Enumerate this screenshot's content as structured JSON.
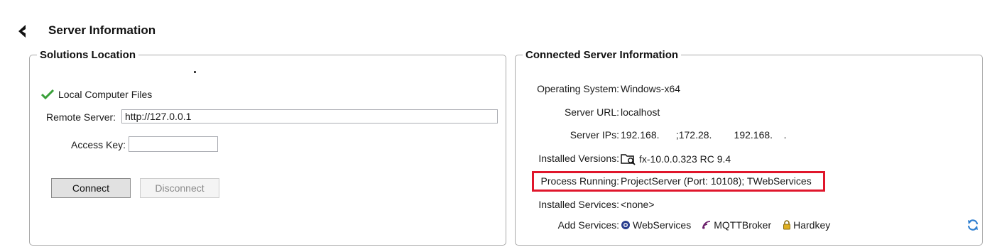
{
  "header": {
    "title": "Server Information"
  },
  "solutions": {
    "legend": "Solutions Location",
    "local_option": "Local Computer Files",
    "remote_label": "Remote Server:",
    "remote_value": "http://127.0.0.1",
    "access_key_label": "Access Key:",
    "access_key_value": "",
    "connect_label": "Connect",
    "disconnect_label": "Disconnect"
  },
  "connected": {
    "legend": "Connected Server Information",
    "os_label": "Operating System:",
    "os_value": "Windows-x64",
    "url_label": "Server URL:",
    "url_value": "localhost",
    "ips_label": "Server IPs:",
    "ips_value": "192.168.      ;172.28.        192.168.    .",
    "versions_label": "Installed Versions:",
    "versions_value": "fx-10.0.0.323 RC 9.4",
    "process_label": "Process Running:",
    "process_value": "ProjectServer (Port: 10108); TWebServices",
    "services_label": "Installed Services:",
    "services_value": "<none>",
    "add_label": "Add Services:",
    "add_services": [
      "WebServices",
      "MQTTBroker",
      "Hardkey"
    ]
  },
  "colors": {
    "highlight": "#e0162b",
    "check": "#3aa03a"
  },
  "icons": [
    "back-arrow-icon",
    "check-icon",
    "folder-search-icon",
    "webservices-icon",
    "mqtt-icon",
    "lock-icon",
    "refresh-icon"
  ]
}
